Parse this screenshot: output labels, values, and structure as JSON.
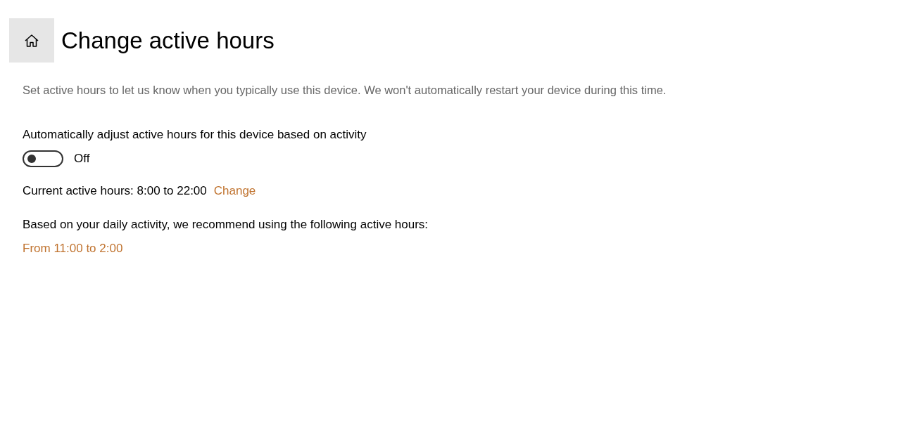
{
  "header": {
    "title": "Change active hours"
  },
  "description": "Set active hours to let us know when you typically use this device. We won't automatically restart your device during this time.",
  "auto_adjust": {
    "label": "Automatically adjust active hours for this device based on activity",
    "on": false,
    "state_text": "Off"
  },
  "current": {
    "text": "Current active hours: 8:00 to 22:00",
    "link": "Change"
  },
  "recommendation": {
    "text": "Based on your daily activity, we recommend using the following active hours:",
    "link": "From 11:00 to 2:00"
  }
}
